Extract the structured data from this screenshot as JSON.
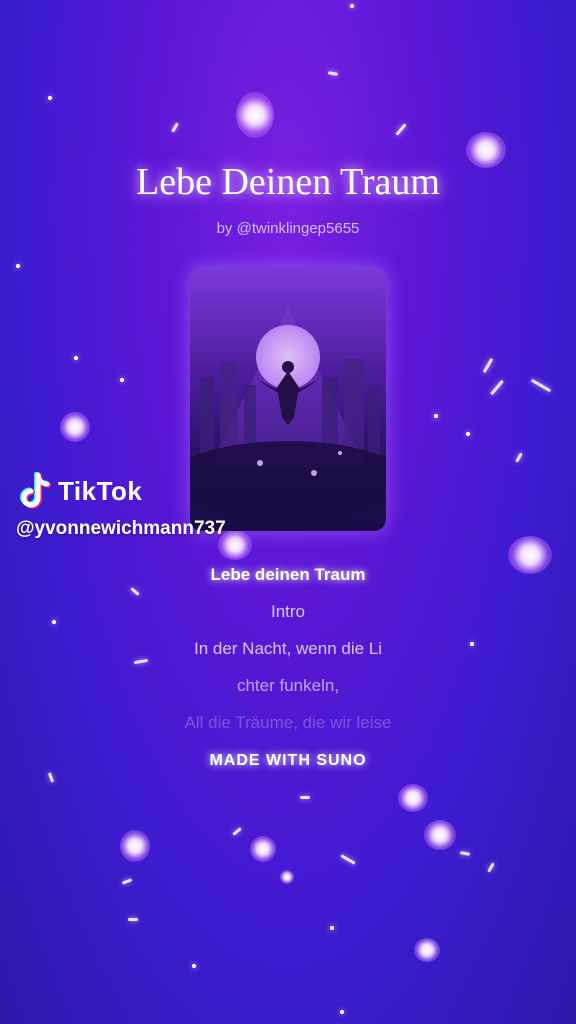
{
  "song": {
    "title": "Lebe Deinen Traum",
    "byline": "by @twinklingep5655"
  },
  "watermark": {
    "brand": "TikTok",
    "handle": "@yvonnewichmann737"
  },
  "lyrics": [
    "Lebe deinen Traum",
    "Intro",
    "In der Nacht, wenn die Li",
    "chter funkeln,",
    "All die Träume, die wir leise"
  ],
  "footer": {
    "made_with": "MADE WITH SUNO"
  },
  "colors": {
    "background_top": "#7a1fe0",
    "background_bottom": "#2a1aa8",
    "glow": "#e6b8ff"
  },
  "icons": {
    "logo": "tiktok-note-icon",
    "decoration": "sparkle-orbs"
  }
}
